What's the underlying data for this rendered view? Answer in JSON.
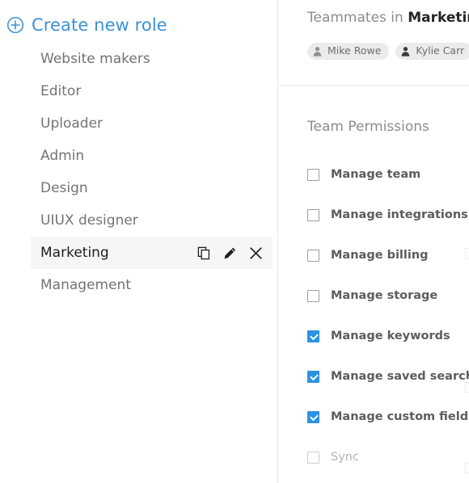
{
  "sidebar": {
    "create_new": {
      "label": "Create new role",
      "icon": "circle-plus-icon",
      "color": "#3b92d4"
    },
    "roles": [
      {
        "label": "Website makers",
        "selected": false
      },
      {
        "label": "Editor",
        "selected": false
      },
      {
        "label": "Uploader",
        "selected": false
      },
      {
        "label": "Admin",
        "selected": false
      },
      {
        "label": "Design",
        "selected": false
      },
      {
        "label": "UIUX designer",
        "selected": false
      },
      {
        "label": "Marketing",
        "selected": true
      },
      {
        "label": "Management",
        "selected": false
      }
    ],
    "row_actions": [
      {
        "name": "duplicate-role-icon",
        "title": "Duplicate"
      },
      {
        "name": "edit-role-icon",
        "title": "Edit"
      },
      {
        "name": "delete-role-icon",
        "title": "Delete"
      }
    ]
  },
  "teammates": {
    "heading_prefix": "Teammates in ",
    "heading_role": "Marketing",
    "members": [
      {
        "name": "Mike Rowe",
        "avatar": "person-avatar-icon"
      },
      {
        "name": "Kylie Carr",
        "avatar": "person-avatar-icon"
      }
    ]
  },
  "permissions": {
    "title": "Team Permissions",
    "accent_color": "#2b92e4",
    "items": [
      {
        "label": "Manage team",
        "checked": false,
        "dim": false
      },
      {
        "label": "Manage integrations",
        "checked": false,
        "dim": false
      },
      {
        "label": "Manage billing",
        "checked": false,
        "dim": false
      },
      {
        "label": "Manage storage",
        "checked": false,
        "dim": false
      },
      {
        "label": "Manage keywords",
        "checked": true,
        "dim": false
      },
      {
        "label": "Manage saved searches",
        "checked": true,
        "dim": false
      },
      {
        "label": "Manage custom fields",
        "checked": true,
        "dim": false
      },
      {
        "label": "Sync",
        "checked": false,
        "dim": true
      }
    ]
  }
}
